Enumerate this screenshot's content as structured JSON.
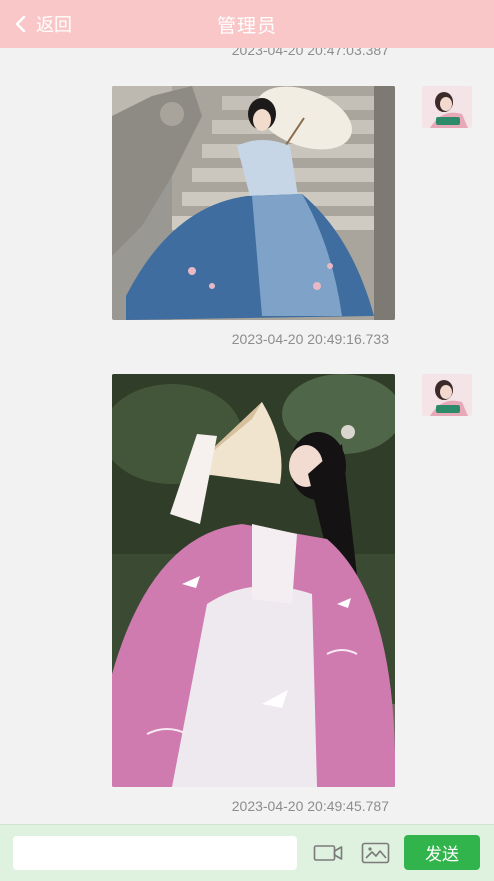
{
  "header": {
    "back_label": "返回",
    "title": "管理员"
  },
  "messages": [
    {
      "timestamp": "2023-04-20 20:47:03.387",
      "content": "image",
      "image_subject": "woman in blue hanfu with paper umbrella on stone steps"
    },
    {
      "timestamp": "2023-04-20 20:49:16.733",
      "content": "image",
      "image_subject": "woman in pink hanfu holding a folding fan"
    },
    {
      "timestamp": "2023-04-20 20:49:45.787"
    }
  ],
  "footer": {
    "input_value": "",
    "send_label": "发送",
    "video_icon": "video-camera-icon",
    "image_icon": "image-picture-icon"
  },
  "colors": {
    "header": "#f9c7c7",
    "background": "#f2f2f2",
    "footer": "#dff1df",
    "send": "#31b44b"
  }
}
